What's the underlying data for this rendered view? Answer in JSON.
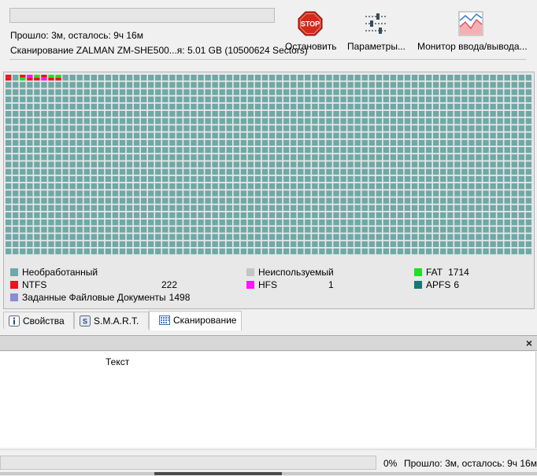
{
  "top": {
    "progress_fraction": 0.0,
    "elapsed_text": "Прошло: 3м, осталось: 9ч 16м",
    "scan_text": "Сканирование ZALMAN ZM-SHE500...я: 5.01 GB (10500624 Sectors)",
    "buttons": {
      "stop_icon_text": "STOP",
      "stop_label": "Остановить",
      "params_label": "Параметры...",
      "monitor_label": "Монитор ввода/вывода..."
    }
  },
  "scan_map": {
    "colors": {
      "raw": "#6fa8a6",
      "ntfs": "#e8141e",
      "fat": "#1fe01f",
      "hfs": "#ff14ff",
      "apfs": "#147a72",
      "unused": "#c4c4c4",
      "docs": "#8c8cd2"
    },
    "legend": [
      {
        "name": "Необработанный",
        "count": "",
        "color_key": "raw"
      },
      {
        "name": "Неиспользуемый",
        "count": "",
        "color_key": "unused"
      },
      {
        "name": "FAT",
        "count": "1714",
        "color_key": "fat"
      },
      {
        "name": "NTFS",
        "count": "222",
        "color_key": "ntfs"
      },
      {
        "name": "HFS",
        "count": "1",
        "color_key": "hfs"
      },
      {
        "name": "APFS",
        "count": "6",
        "color_key": "apfs"
      },
      {
        "name": "Заданные Файловые Документы",
        "count": "1498",
        "color_key": "docs"
      }
    ]
  },
  "tabs": [
    {
      "label": "Свойства",
      "icon": "info-icon"
    },
    {
      "label": "S.M.A.R.T.",
      "icon": "smart-icon"
    },
    {
      "label": "Сканирование",
      "icon": "scan-icon"
    }
  ],
  "lower": {
    "close_glyph": "×",
    "column_header": "Текст"
  },
  "status": {
    "percent": "0%",
    "text": "Прошло: 3м, осталось: 9ч 16м"
  }
}
